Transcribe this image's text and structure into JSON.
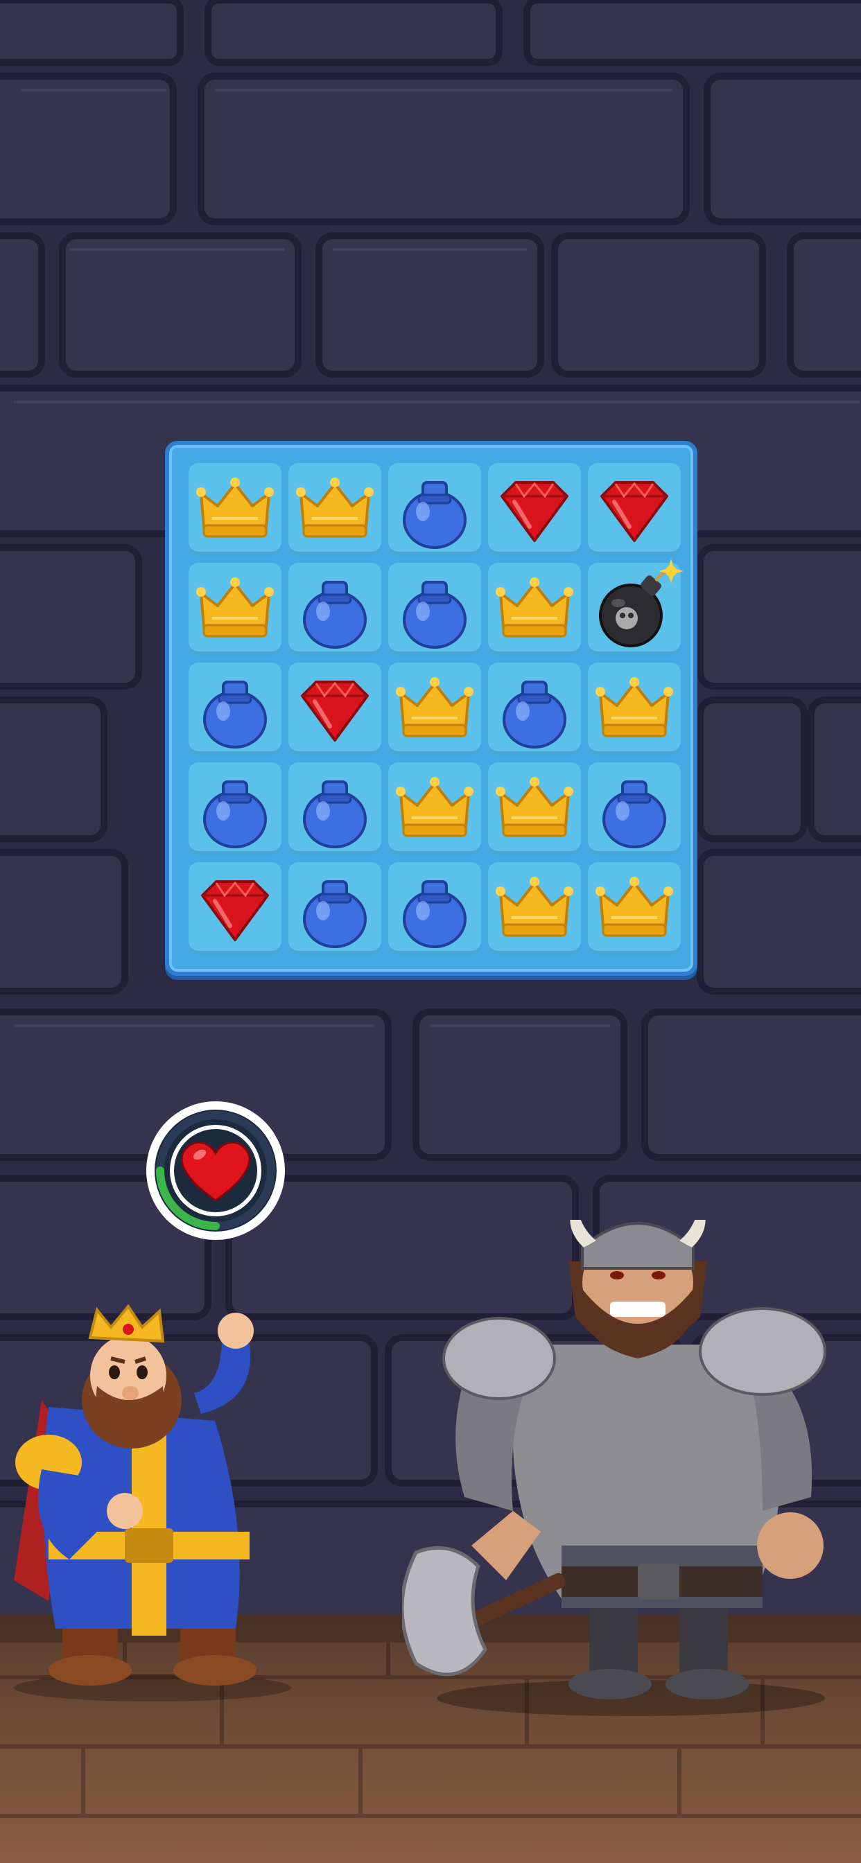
{
  "board": {
    "rows": 5,
    "cols": 5,
    "tiles": [
      [
        "crown",
        "crown",
        "potion",
        "gem",
        "gem"
      ],
      [
        "crown",
        "potion",
        "potion",
        "crown",
        "bomb"
      ],
      [
        "potion",
        "gem",
        "crown",
        "potion",
        "crown"
      ],
      [
        "potion",
        "potion",
        "crown",
        "crown",
        "potion"
      ],
      [
        "gem",
        "potion",
        "potion",
        "crown",
        "crown"
      ]
    ]
  },
  "health_meter": {
    "icon": "heart-icon",
    "fill_fraction": 0.25,
    "ring_color": "#3bb54a"
  },
  "characters": {
    "hero": "king",
    "enemy": "viking-warrior"
  },
  "colors": {
    "board_bg": "#47a8e6",
    "cell_bg": "#5bc0ea",
    "crown": "#f5b820",
    "potion": "#3d6fe0",
    "gem": "#d8141c",
    "wall": "#2d2a45"
  }
}
